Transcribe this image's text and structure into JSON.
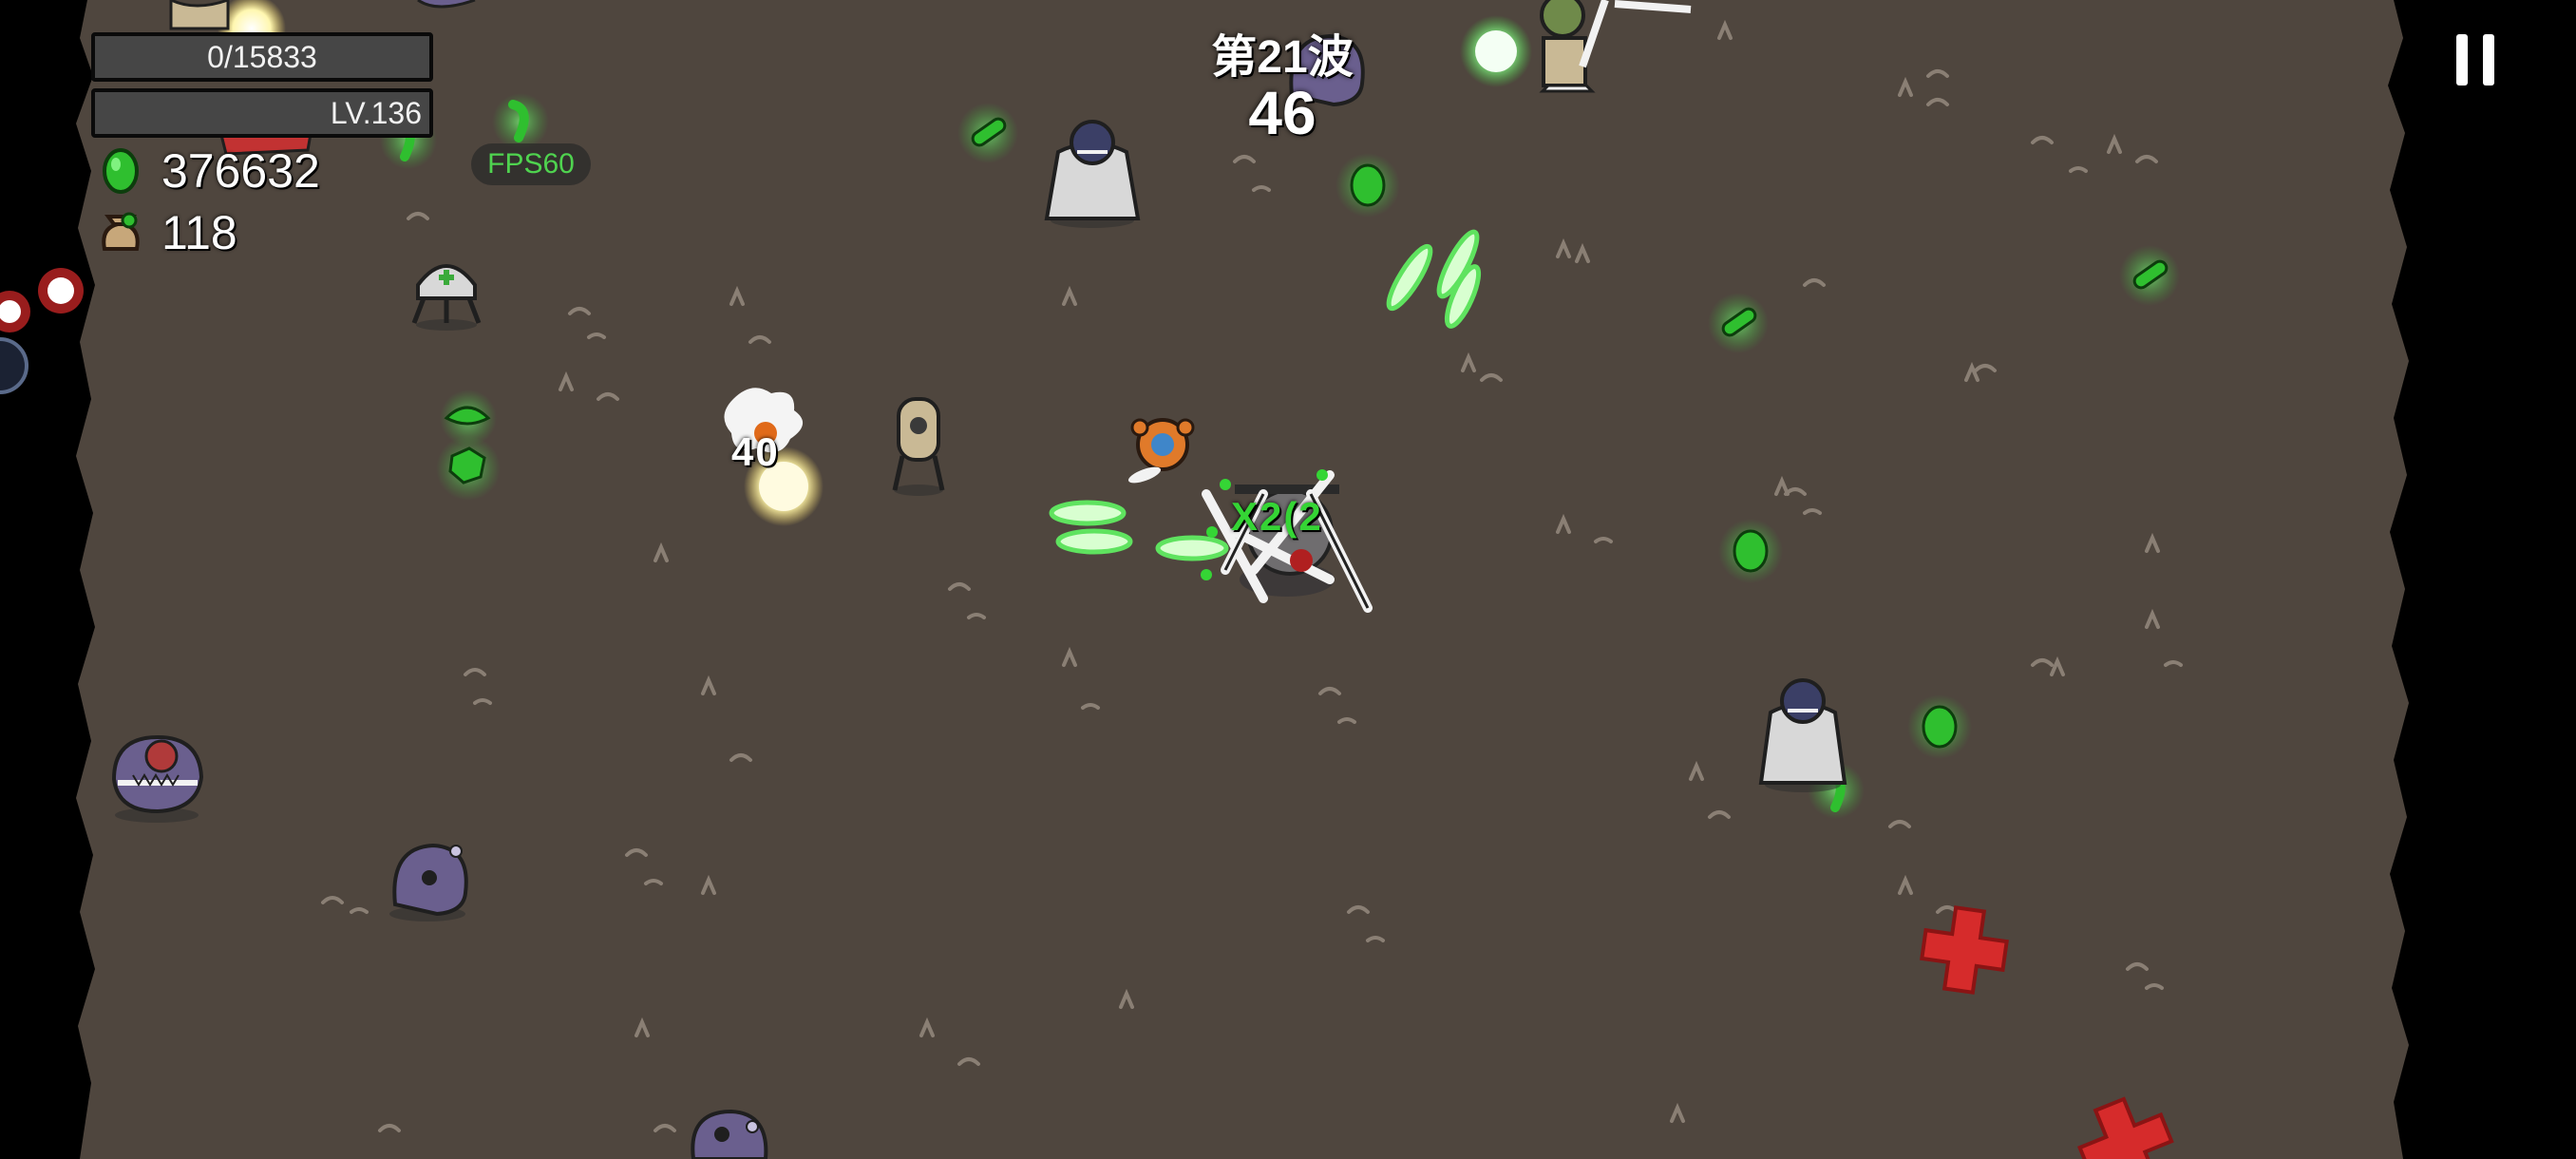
{
  "hud": {
    "experience_text": "0/15833",
    "level_text": "LV.136",
    "materials_count": "376632",
    "materials_icon": "green-material-icon",
    "bag_count": "118",
    "bag_icon": "money-bag-icon",
    "fps_text": "FPS60"
  },
  "wave": {
    "label": "第21波",
    "timer": "46"
  },
  "controls": {
    "pause_icon": "pause-icon"
  },
  "floating_text": {
    "damage": "40",
    "combo": "X2(2"
  },
  "colors": {
    "ground": "#4f463e",
    "border": "#000000",
    "material_green": "#2fbf2f",
    "enemy_purple": "#6a5f8e",
    "danger_red": "#d62b2b",
    "hud_text": "#ffffff",
    "fps_text": "#4fd34f"
  }
}
